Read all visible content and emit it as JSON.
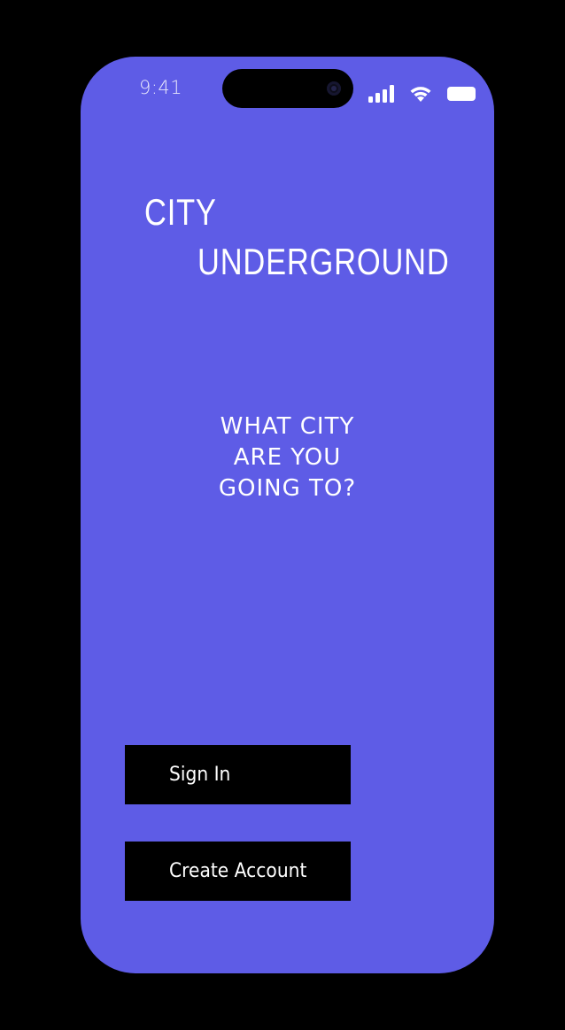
{
  "status_bar": {
    "time": "9:41",
    "icons": [
      "signal-icon",
      "wifi-icon",
      "battery-icon"
    ]
  },
  "app": {
    "title_line1": "CITY",
    "title_line2": "UNDERGROUND"
  },
  "prompt": {
    "line1": "WHAT CITY",
    "line2": "ARE YOU",
    "line3": "GOING TO?"
  },
  "actions": {
    "sign_in": "Sign In",
    "create_account": "Create Account"
  },
  "colors": {
    "background": "#000000",
    "screen": "#5e5ce6",
    "text": "#ffffff",
    "button": "#000000"
  }
}
